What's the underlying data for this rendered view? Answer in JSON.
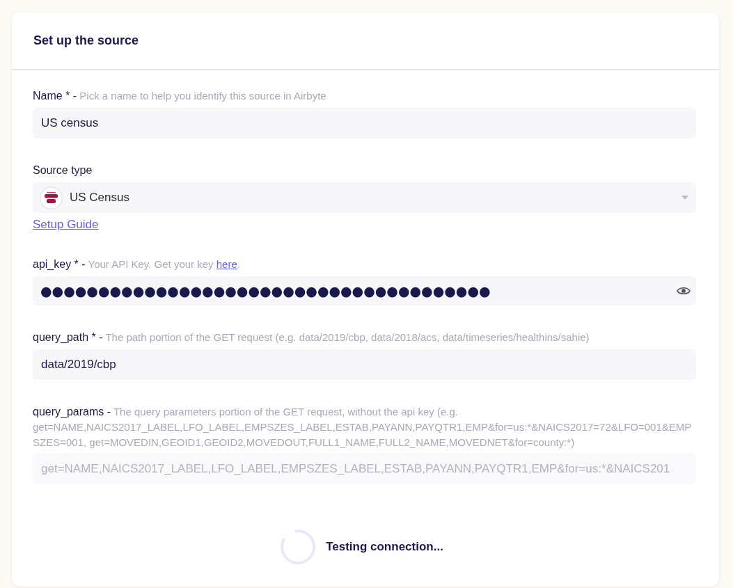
{
  "card": {
    "title": "Set up the source"
  },
  "fields": [
    {
      "kind": "text",
      "label": "Name * -",
      "description": "Pick a name to help you identify this source in Airbyte",
      "value": "US census"
    },
    {
      "kind": "select",
      "label": "Source type",
      "value": "US Census",
      "guide_link": "Setup Guide"
    },
    {
      "kind": "password",
      "label": "api_key * -",
      "description": "Your API Key. Get your key",
      "description_link": "here",
      "description_end": ".",
      "value": "●●●●●●●●●●●●●●●●●●●●●●●●●●●●●●●●●●●●●●●"
    },
    {
      "kind": "text",
      "label": "query_path * -",
      "description": "The path portion of the GET request (e.g. data/2019/cbp, data/2018/acs, data/timeseries/healthins/sahie)",
      "value": "data/2019/cbp"
    },
    {
      "kind": "text",
      "label": "query_params -",
      "description": "The query parameters portion of the GET request, without the api key (e.g. get=NAME,NAICS2017_LABEL,LFO_LABEL,EMPSZES_LABEL,ESTAB,PAYANN,PAYQTR1,EMP&for=us:*&NAICS2017=72&LFO=001&EMPSZES=001, get=MOVEDIN,GEOID1,GEOID2,MOVEDOUT,FULL1_NAME,FULL2_NAME,MOVEDNET&for=county:*)",
      "placeholder": "get=NAME,NAICS2017_LABEL,LFO_LABEL,EMPSZES_LABEL,ESTAB,PAYANN,PAYQTR1,EMP&for=us:*&NAICS201"
    }
  ],
  "connection_test": {
    "text": "Testing connection..."
  }
}
